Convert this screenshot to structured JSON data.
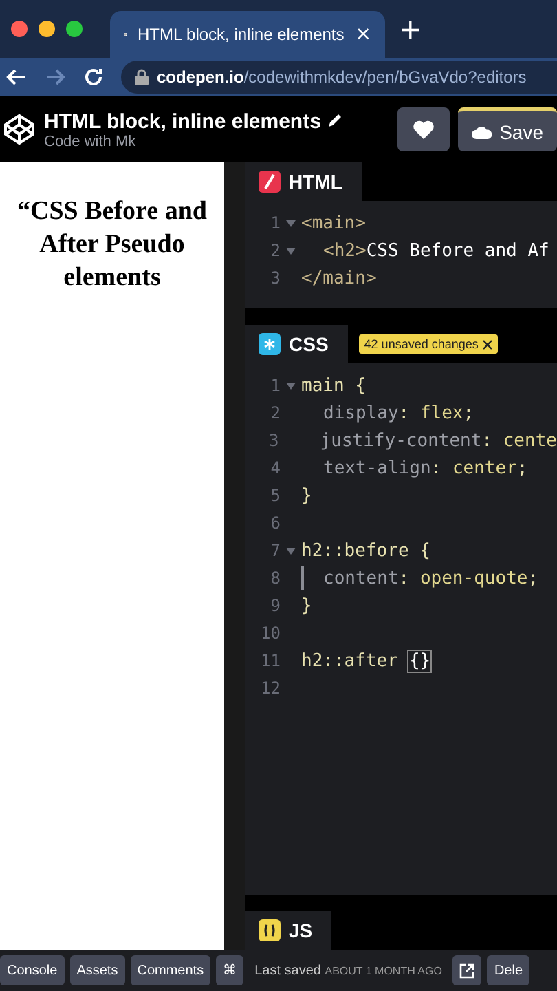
{
  "browser": {
    "tab": {
      "title": "HTML block, inline elements",
      "close": "×"
    },
    "new_tab": "+",
    "url_host": "codepen.io",
    "url_path": "/codewithmkdev/pen/bGvaVdo?editors"
  },
  "header": {
    "title": "HTML block, inline elements",
    "author": "Code with Mk",
    "save": "Save"
  },
  "preview": {
    "heading": "“CSS Before and After Pseudo elements"
  },
  "editors": [
    {
      "kind": "html",
      "label": "HTML",
      "lines": [
        {
          "number": "1",
          "fold": true,
          "tokens": [
            {
              "kind": "tag",
              "text": "<main>"
            }
          ]
        },
        {
          "number": "2",
          "fold": true,
          "indent": true,
          "tokens": [
            {
              "kind": "tag",
              "text": "<h2>"
            },
            {
              "kind": "text",
              "text": "CSS Before and Af"
            }
          ]
        },
        {
          "number": "3",
          "fold": false,
          "tokens": [
            {
              "kind": "tag",
              "text": "</main>"
            }
          ]
        }
      ]
    },
    {
      "kind": "css",
      "label": "CSS",
      "badge": "42 unsaved changes",
      "lines": [
        {
          "number": "1",
          "fold": true,
          "tokens": [
            {
              "kind": "selector",
              "text": "main"
            },
            {
              "kind": "punct",
              "text": " {"
            }
          ]
        },
        {
          "number": "2",
          "fold": false,
          "indent": true,
          "tokens": [
            {
              "kind": "prop",
              "text": "display"
            },
            {
              "kind": "punct",
              "text": ": "
            },
            {
              "kind": "value",
              "text": "flex"
            },
            {
              "kind": "punct",
              "text": ";"
            }
          ]
        },
        {
          "number": "3",
          "fold": false,
          "indent": true,
          "tokens": [
            {
              "kind": "prop",
              "text": "justify-content"
            },
            {
              "kind": "punct",
              "text": ": "
            },
            {
              "kind": "value",
              "text": "cente"
            }
          ]
        },
        {
          "number": "4",
          "fold": false,
          "indent": true,
          "tokens": [
            {
              "kind": "prop",
              "text": "text-align"
            },
            {
              "kind": "punct",
              "text": ": "
            },
            {
              "kind": "value",
              "text": "center"
            },
            {
              "kind": "punct",
              "text": ";"
            }
          ]
        },
        {
          "number": "5",
          "fold": false,
          "tokens": [
            {
              "kind": "punct",
              "text": "}"
            }
          ]
        },
        {
          "number": "6",
          "fold": false
        },
        {
          "number": "7",
          "fold": true,
          "tokens": [
            {
              "kind": "selector",
              "text": "h2::before"
            },
            {
              "kind": "punct",
              "text": " {"
            }
          ]
        },
        {
          "number": "8",
          "fold": false,
          "indent": true,
          "active": true,
          "tokens": [
            {
              "kind": "prop",
              "text": "content"
            },
            {
              "kind": "punct",
              "text": ": "
            },
            {
              "kind": "value",
              "text": "open-quote"
            },
            {
              "kind": "punct",
              "text": ";"
            }
          ]
        },
        {
          "number": "9",
          "fold": false,
          "tokens": [
            {
              "kind": "punct",
              "text": "}"
            }
          ]
        },
        {
          "number": "10",
          "fold": false
        },
        {
          "number": "11",
          "fold": false,
          "tokens": [
            {
              "kind": "selector",
              "text": "h2::after"
            },
            {
              "kind": "bracket",
              "text": "{}"
            }
          ]
        },
        {
          "number": "12",
          "fold": false
        }
      ]
    },
    {
      "kind": "js",
      "label": "JS"
    }
  ],
  "footer": {
    "buttons": [
      "Console",
      "Assets",
      "Comments"
    ],
    "shortcut": "⌘",
    "saved_label": "Last saved",
    "saved_time": "ABOUT 1 MONTH AGO",
    "delete": "Dele"
  }
}
